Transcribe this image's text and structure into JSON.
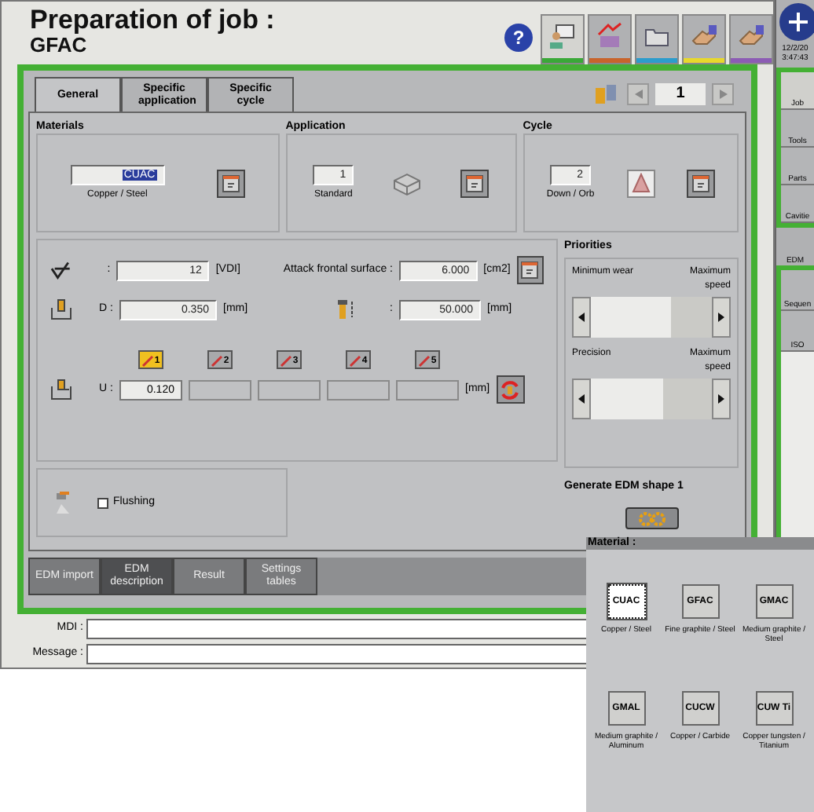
{
  "title": "Preparation of job :",
  "subtitle": "GFAC",
  "help": "?",
  "toolbar": [
    {
      "selected": true,
      "color": "#3aa838"
    },
    {
      "selected": false,
      "color": "#c8642c"
    },
    {
      "selected": false,
      "color": "#2c9ccc"
    },
    {
      "selected": false,
      "color": "#e8d82c"
    },
    {
      "selected": false,
      "color": "#8c5cb4"
    }
  ],
  "tabs": [
    {
      "label": "General",
      "selected": true
    },
    {
      "label": "Specific application",
      "selected": false
    },
    {
      "label": "Specific cycle",
      "selected": false
    }
  ],
  "page_number": "1",
  "groups": [
    {
      "kind": "material",
      "title": "Materials",
      "value": "CUAC",
      "caption": "Copper / Steel"
    },
    {
      "kind": "application",
      "title": "Application",
      "value": "1",
      "caption": "Standard"
    },
    {
      "kind": "cycle",
      "title": "Cycle",
      "value": "2",
      "caption": "Down / Orb"
    }
  ],
  "roughness": {
    "label": ":",
    "value": "12",
    "unit": "[VDI]"
  },
  "attack": {
    "label": "Attack frontal surface :",
    "value": "6.000",
    "unit": "[cm2]"
  },
  "depth": {
    "label": "D :",
    "value": "0.350",
    "unit": "[mm]"
  },
  "length": {
    "label": ":",
    "value": "50.000",
    "unit": "[mm]"
  },
  "undersize": {
    "label": "U :",
    "unit": "[mm]",
    "electrodes": [
      {
        "number": "1",
        "selected": true,
        "value": "0.120"
      },
      {
        "number": "2",
        "selected": false
      },
      {
        "number": "3",
        "selected": false
      },
      {
        "number": "4",
        "selected": false
      },
      {
        "number": "5",
        "selected": false
      }
    ]
  },
  "flushing": {
    "label": "Flushing",
    "checked": false
  },
  "priorities": {
    "title": "Priorities",
    "sliders": [
      {
        "left": "Minimum wear",
        "right": "Maximum speed",
        "level": 0.66
      },
      {
        "left": "Precision",
        "right": "Maximum speed",
        "level": 0.6
      }
    ]
  },
  "generate": {
    "title": "Generate EDM shape 1"
  },
  "bottom_tabs": [
    {
      "label": "EDM import",
      "selected": false
    },
    {
      "label": "EDM description",
      "selected": true
    },
    {
      "label": "Result",
      "selected": false
    },
    {
      "label": "Settings tables",
      "selected": false
    }
  ],
  "mdi": {
    "label": "MDI :"
  },
  "message": {
    "label": "Message :"
  },
  "sidebar": {
    "date": "12/2/20",
    "time": "3:47:43",
    "top": [
      {
        "label": "Job",
        "selected": true
      },
      {
        "label": "Tools",
        "selected": false
      },
      {
        "label": "Parts",
        "selected": false
      },
      {
        "label": "Cavitie",
        "selected": false
      }
    ],
    "middle": "EDM",
    "bottom": [
      {
        "label": "Sequen",
        "selected": false
      },
      {
        "label": "ISO",
        "selected": false
      }
    ]
  },
  "popup": {
    "title": "Material :",
    "items": [
      {
        "code": "CUAC",
        "caption": "Copper / Steel",
        "selected": true
      },
      {
        "code": "GFAC",
        "caption": "Fine graphite / Steel",
        "selected": false
      },
      {
        "code": "GMAC",
        "caption": "Medium graphite / Steel",
        "selected": false
      },
      {
        "code": "GMAL",
        "caption": "Medium graphite / Aluminum",
        "selected": false
      },
      {
        "code": "CUCW",
        "caption": "Copper / Carbide",
        "selected": false
      },
      {
        "code": "CUW Ti",
        "caption": "Copper tungsten / Titanium",
        "selected": false
      }
    ]
  }
}
